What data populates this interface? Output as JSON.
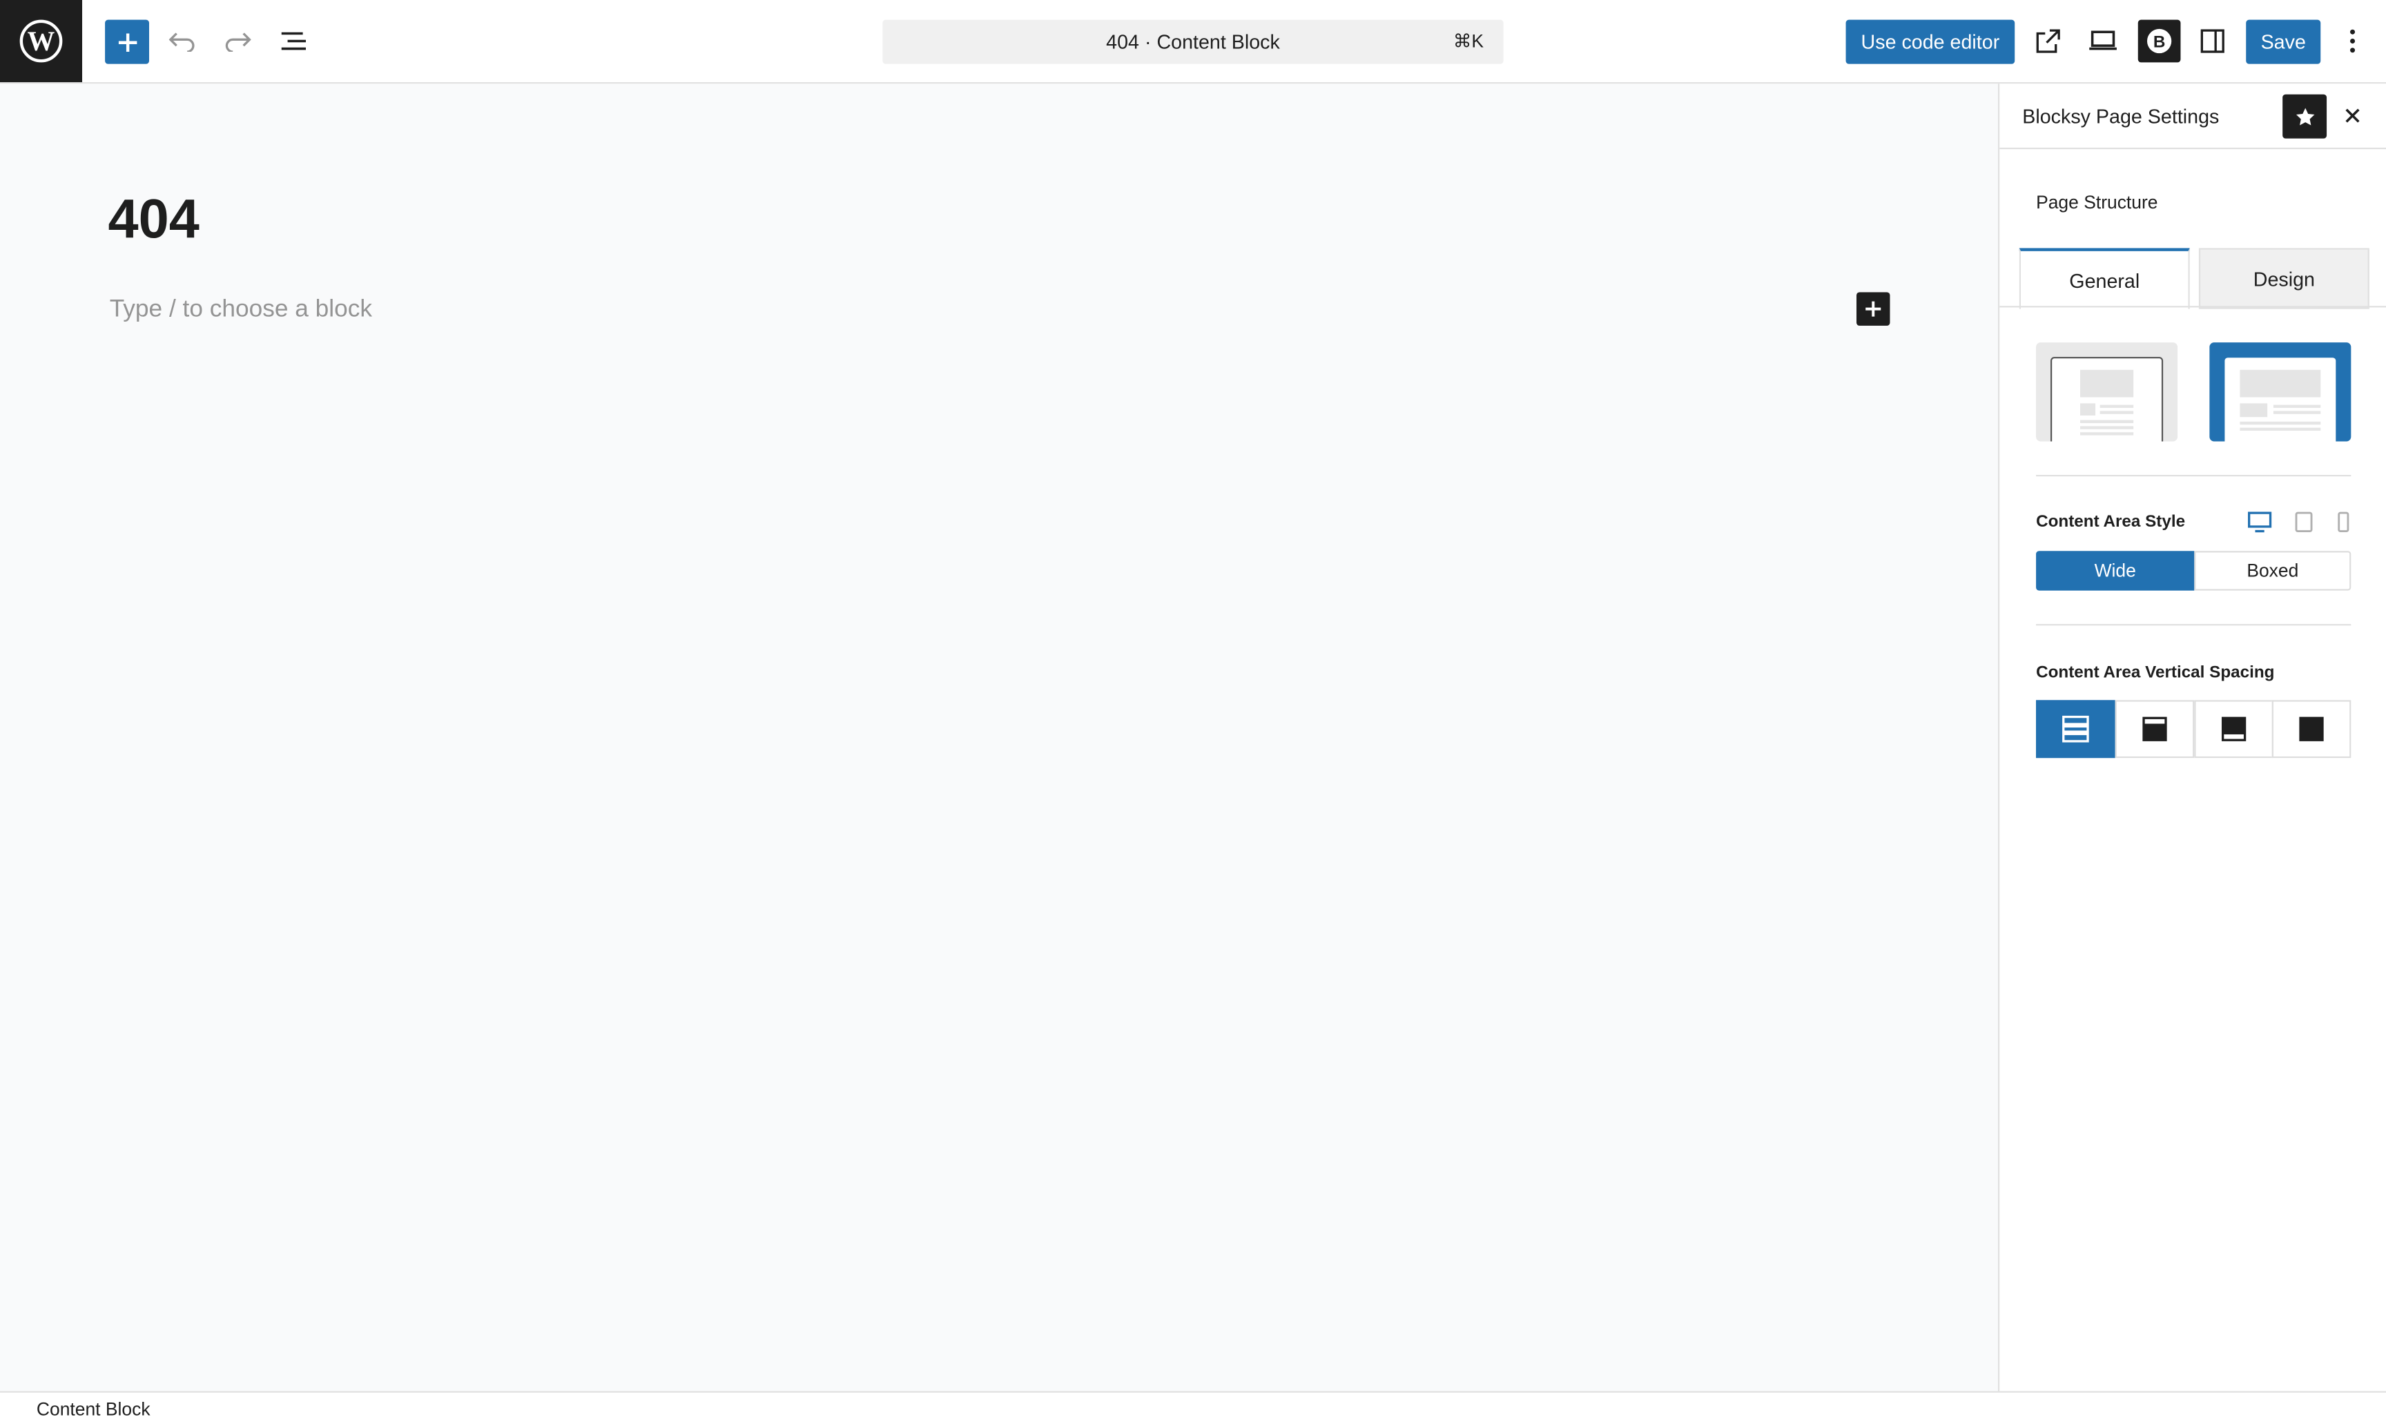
{
  "toolbar": {
    "document_title": "404 · Content Block",
    "shortcut": "⌘K",
    "code_editor_label": "Use code editor",
    "save_label": "Save",
    "icons": [
      "wordpress-logo-icon",
      "plus-icon",
      "undo-icon",
      "redo-icon",
      "list-view-icon",
      "external-link-icon",
      "laptop-icon",
      "blocksy-icon",
      "sidebar-toggle-icon",
      "more-vertical-icon"
    ]
  },
  "editor": {
    "title": "404",
    "placeholder": "Type / to choose a block"
  },
  "sidebar": {
    "title": "Blocksy Page Settings",
    "section": "Page Structure",
    "tabs": [
      {
        "label": "General",
        "active": true
      },
      {
        "label": "Design",
        "active": false
      }
    ],
    "structure_selected": 1,
    "content_area_style": {
      "label": "Content Area Style",
      "options": [
        "Wide",
        "Boxed"
      ],
      "selected": "Wide",
      "devices": [
        "desktop-icon",
        "tablet-icon",
        "mobile-icon"
      ]
    },
    "vertical_spacing": {
      "label": "Content Area Vertical Spacing",
      "selected_index": 0
    }
  },
  "footer": {
    "breadcrumb": "Content Block"
  },
  "colors": {
    "accent": "#2271b1",
    "dark": "#1e1e1e",
    "canvas": "#f9fafb"
  }
}
